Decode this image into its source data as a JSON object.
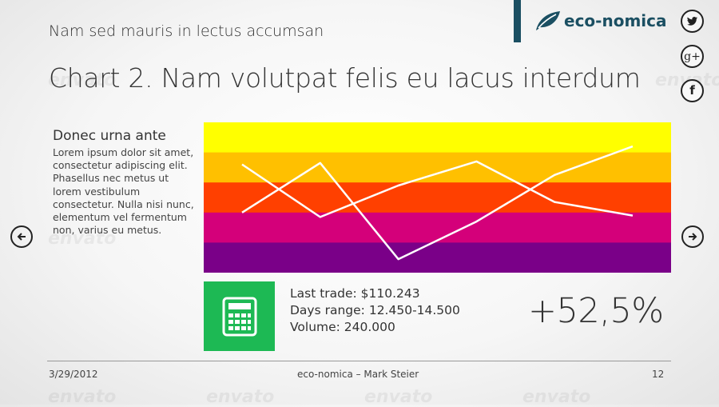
{
  "header": {
    "subtitle": "Nam sed mauris in lectus accumsan",
    "title": "Chart 2. Nam volutpat felis eu lacus interdum"
  },
  "brand": {
    "name": "eco-nomica",
    "color": "#1b4f62"
  },
  "social": [
    {
      "icon": "twitter-icon"
    },
    {
      "icon": "google-plus-icon",
      "label": "g+"
    },
    {
      "icon": "facebook-icon",
      "label": "f"
    }
  ],
  "navigation": {
    "prev_icon": "arrow-left-icon",
    "next_icon": "arrow-right-icon"
  },
  "sidebar": {
    "heading": "Donec urna ante",
    "body": "Lorem ipsum dolor sit amet, consectetur adipiscing elit. Phasellus nec metus ut lorem vestibulum consectetur. Nulla nisi nunc, elementum vel fermentum non, varius eu metus."
  },
  "chart_data": {
    "type": "line",
    "bands": [
      "#ffff00",
      "#ffc000",
      "#ff4000",
      "#d4007a",
      "#7a0088"
    ],
    "line_color": "#ffffff",
    "ylim": [
      0,
      100
    ],
    "series": [
      {
        "values": [
          72,
          37,
          58,
          74,
          47,
          38
        ]
      },
      {
        "values": [
          40,
          73,
          9,
          34,
          65,
          84
        ]
      }
    ]
  },
  "stats": {
    "icon": "calculator-icon",
    "icon_bg": "#1db954",
    "last_trade": "Last trade: $110.243",
    "days_range": "Days range: 12.450-14.500",
    "volume": "Volume: 240.000",
    "change": "+52,5%"
  },
  "footer": {
    "date": "3/29/2012",
    "center": "eco-nomica – Mark Steier",
    "page": "12"
  },
  "watermark": "envato"
}
